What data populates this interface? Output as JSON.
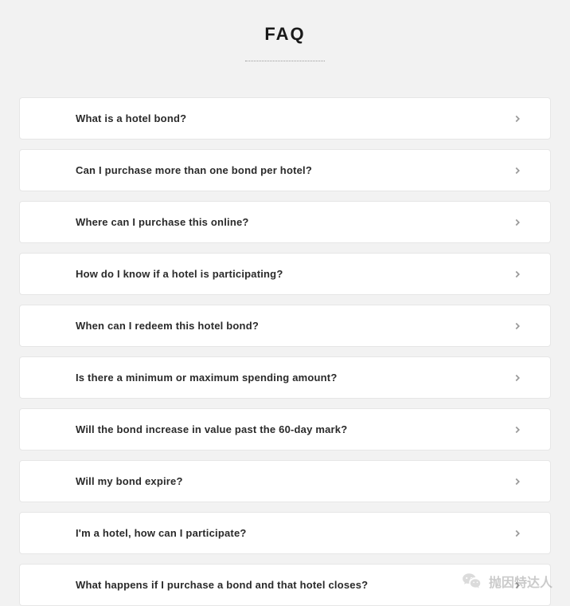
{
  "header": {
    "title": "FAQ"
  },
  "faq": {
    "items": [
      {
        "question": "What is a hotel bond?"
      },
      {
        "question": "Can I purchase more than one bond per hotel?"
      },
      {
        "question": "Where can I purchase this online?"
      },
      {
        "question": "How do I know if a hotel is participating?"
      },
      {
        "question": "When can I redeem this hotel bond?"
      },
      {
        "question": "Is there a minimum or maximum spending amount?"
      },
      {
        "question": "Will the bond increase in value past the 60-day mark?"
      },
      {
        "question": "Will my bond expire?"
      },
      {
        "question": "I'm a hotel, how can I participate?"
      },
      {
        "question": "What happens if I purchase a bond and that hotel closes?"
      }
    ]
  },
  "watermark": {
    "text": "抛因特达人"
  }
}
